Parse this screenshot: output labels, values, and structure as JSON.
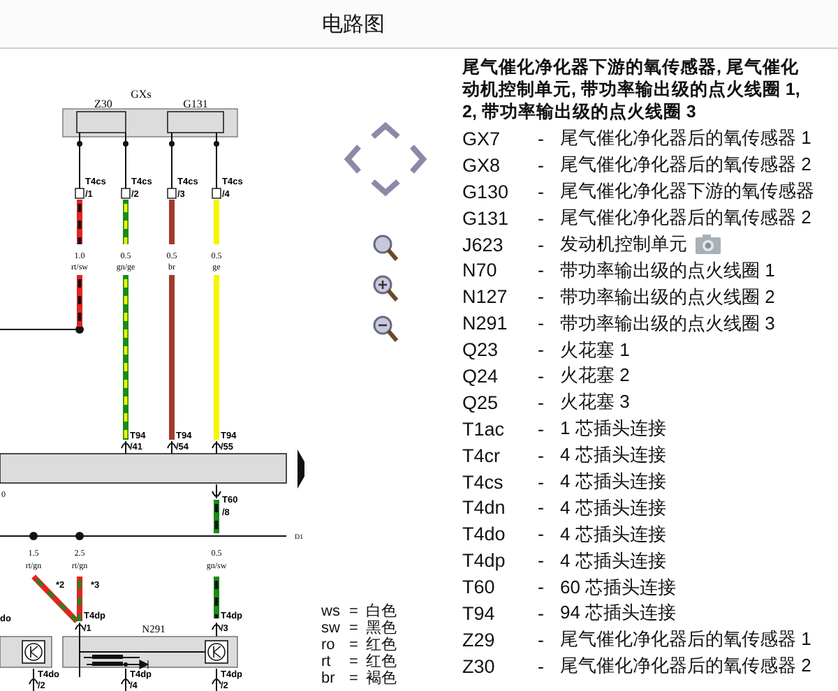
{
  "window": {
    "title": "电路图"
  },
  "diagram": {
    "component": "GXs",
    "parts": [
      "Z30",
      "G131"
    ],
    "top_wires": [
      {
        "kind": "splice",
        "connector": "T4cs",
        "pin": "/1",
        "gauge": "1.0",
        "code": "rt/sw",
        "color": "#e52222",
        "stripe": {
          "color": "#111111"
        }
      },
      {
        "kind": "connector",
        "connector": "T4cs",
        "pin": "/2",
        "gauge": "0.5",
        "code": "gn/ge",
        "color": "#1a8a1a",
        "stripe": {
          "color": "#f2f200"
        },
        "end_connector": "T94",
        "end_pin": "/41"
      },
      {
        "kind": "connector",
        "connector": "T4cs",
        "pin": "/3",
        "gauge": "0.5",
        "code": "br",
        "color": "#a33a2e",
        "end_connector": "T94",
        "end_pin": "/54"
      },
      {
        "kind": "connector",
        "connector": "T4cs",
        "pin": "/4",
        "gauge": "0.5",
        "code": "ge",
        "color": "#f5f500",
        "end_connector": "T94",
        "end_pin": "/55"
      }
    ],
    "edge_label": "0",
    "bus_label": "D1",
    "bus_wires": [
      {
        "gauge": "1.5",
        "code": "rt/gn",
        "note": "*2",
        "color": "#e52222",
        "stripe": {
          "color": "#1a8a1a"
        }
      },
      {
        "gauge": "2.5",
        "code": "rt/gn",
        "note": "*3",
        "color": "#e52222",
        "stripe": {
          "color": "#1a8a1a"
        }
      }
    ],
    "feed": {
      "connector": "T60",
      "pin": "/8",
      "gauge": "0.5",
      "code": "gn/sw",
      "color": "#1a8a1a",
      "stripe": {
        "color": "#111111"
      }
    },
    "module_connectors": [
      {
        "connector": "T4dp",
        "pin": "/1"
      },
      {
        "connector": "T4dp",
        "pin": "/3"
      }
    ],
    "left_label": "do",
    "module": "N291",
    "bottom_connectors": [
      {
        "connector": "T4do",
        "pin": "/2"
      },
      {
        "connector": "T4dp",
        "pin": "/4"
      },
      {
        "connector": "T4dp",
        "pin": "/2"
      }
    ]
  },
  "color_codes": [
    {
      "code": "ws",
      "sep": "=",
      "name": "白色"
    },
    {
      "code": "sw",
      "sep": "=",
      "name": "黑色"
    },
    {
      "code": "ro",
      "sep": "=",
      "name": "红色"
    },
    {
      "code": "rt",
      "sep": "=",
      "name": "红色"
    },
    {
      "code": "br",
      "sep": "=",
      "name": "褐色"
    }
  ],
  "legend": {
    "heading": [
      "尾气催化净化器下游的氧传感器, 尾气催化",
      "动机控制单元, 带功率输出级的点火线圈 1,",
      "2, 带功率输出级的点火线圈 3"
    ],
    "separator": "-",
    "items": [
      {
        "code": "GX7",
        "text": "尾气催化净化器后的氧传感器 1"
      },
      {
        "code": "GX8",
        "text": "尾气催化净化器后的氧传感器 2"
      },
      {
        "code": "G130",
        "text": "尾气催化净化器下游的氧传感器"
      },
      {
        "code": "G131",
        "text": "尾气催化净化器后的氧传感器 2"
      },
      {
        "code": "J623",
        "text": "发动机控制单元",
        "photo": true
      },
      {
        "code": "N70",
        "text": "带功率输出级的点火线圈 1"
      },
      {
        "code": "N127",
        "text": "带功率输出级的点火线圈 2"
      },
      {
        "code": "N291",
        "text": "带功率输出级的点火线圈 3"
      },
      {
        "code": "Q23",
        "text": "火花塞 1"
      },
      {
        "code": "Q24",
        "text": "火花塞 2"
      },
      {
        "code": "Q25",
        "text": "火花塞 3"
      },
      {
        "code": "T1ac",
        "text": "1 芯插头连接"
      },
      {
        "code": "T4cr",
        "text": "4 芯插头连接"
      },
      {
        "code": "T4cs",
        "text": "4 芯插头连接"
      },
      {
        "code": "T4dn",
        "text": "4 芯插头连接"
      },
      {
        "code": "T4do",
        "text": "4 芯插头连接"
      },
      {
        "code": "T4dp",
        "text": "4 芯插头连接"
      },
      {
        "code": "T60",
        "text": "60 芯插头连接"
      },
      {
        "code": "T94",
        "text": "94 芯插头连接"
      },
      {
        "code": "Z29",
        "text": "尾气催化净化器后的氧传感器 1"
      },
      {
        "code": "Z30",
        "text": "尾气催化净化器后的氧传感器 2"
      }
    ]
  }
}
